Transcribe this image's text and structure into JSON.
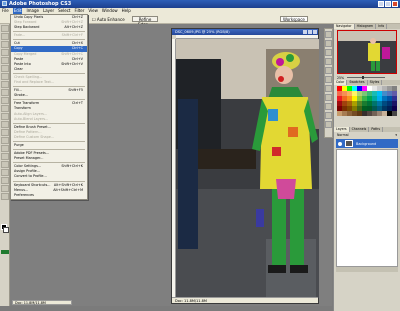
{
  "app": {
    "title": "Adobe Photoshop CS3",
    "accent": "#316ac5"
  },
  "menubar": {
    "items": [
      "File",
      "Edit",
      "Image",
      "Layer",
      "Select",
      "Filter",
      "View",
      "Window",
      "Help"
    ],
    "active": "Edit"
  },
  "options_bar": {
    "checkbox_label": "Auto Enhance",
    "refine_button": "Refine Edge...",
    "workspace_label": "Workspace"
  },
  "edit_menu": {
    "items": [
      {
        "label": "Undo Copy Pixels",
        "shortcut": "Ctrl+Z",
        "state": "normal"
      },
      {
        "label": "Step Forward",
        "shortcut": "Shift+Ctrl+Z",
        "state": "disabled"
      },
      {
        "label": "Step Backward",
        "shortcut": "Alt+Ctrl+Z",
        "state": "normal"
      },
      {
        "sep": true
      },
      {
        "label": "Fade...",
        "shortcut": "Shift+Ctrl+F",
        "state": "disabled"
      },
      {
        "sep": true
      },
      {
        "label": "Cut",
        "shortcut": "Ctrl+X",
        "state": "normal"
      },
      {
        "label": "Copy",
        "shortcut": "Ctrl+C",
        "state": "selected"
      },
      {
        "label": "Copy Merged",
        "shortcut": "Shift+Ctrl+C",
        "state": "disabled"
      },
      {
        "label": "Paste",
        "shortcut": "Ctrl+V",
        "state": "normal"
      },
      {
        "label": "Paste Into",
        "shortcut": "Shift+Ctrl+V",
        "state": "normal"
      },
      {
        "label": "Clear",
        "shortcut": "",
        "state": "normal"
      },
      {
        "sep": true
      },
      {
        "label": "Check Spelling...",
        "shortcut": "",
        "state": "disabled"
      },
      {
        "label": "Find and Replace Text...",
        "shortcut": "",
        "state": "disabled"
      },
      {
        "sep": true
      },
      {
        "label": "Fill...",
        "shortcut": "Shift+F5",
        "state": "normal"
      },
      {
        "label": "Stroke...",
        "shortcut": "",
        "state": "normal"
      },
      {
        "sep": true
      },
      {
        "label": "Free Transform",
        "shortcut": "Ctrl+T",
        "state": "normal"
      },
      {
        "label": "Transform",
        "shortcut": "",
        "state": "normal"
      },
      {
        "label": "Auto-Align Layers...",
        "shortcut": "",
        "state": "disabled"
      },
      {
        "label": "Auto-Blend Layers...",
        "shortcut": "",
        "state": "disabled"
      },
      {
        "sep": true
      },
      {
        "label": "Define Brush Preset...",
        "shortcut": "",
        "state": "normal"
      },
      {
        "label": "Define Pattern...",
        "shortcut": "",
        "state": "disabled"
      },
      {
        "label": "Define Custom Shape...",
        "shortcut": "",
        "state": "disabled"
      },
      {
        "sep": true
      },
      {
        "label": "Purge",
        "shortcut": "",
        "state": "normal"
      },
      {
        "sep": true
      },
      {
        "label": "Adobe PDF Presets...",
        "shortcut": "",
        "state": "normal"
      },
      {
        "label": "Preset Manager...",
        "shortcut": "",
        "state": "normal"
      },
      {
        "sep": true
      },
      {
        "label": "Color Settings...",
        "shortcut": "Shift+Ctrl+K",
        "state": "normal"
      },
      {
        "label": "Assign Profile...",
        "shortcut": "",
        "state": "normal"
      },
      {
        "label": "Convert to Profile...",
        "shortcut": "",
        "state": "normal"
      },
      {
        "sep": true
      },
      {
        "label": "Keyboard Shortcuts...",
        "shortcut": "Alt+Shift+Ctrl+K",
        "state": "normal"
      },
      {
        "label": "Menus...",
        "shortcut": "Alt+Shift+Ctrl+M",
        "state": "normal"
      },
      {
        "label": "Preferences",
        "shortcut": "",
        "state": "normal"
      }
    ]
  },
  "document": {
    "title": "DSC_0609.JPG @ 25% (RGB/8)",
    "zoom": "25%",
    "status": "Doc: 11.8M/11.8M"
  },
  "left_status": "Doc: 11.8M/11.8M",
  "panels": {
    "navigator_tabs": [
      "Navigator",
      "Histogram",
      "Info"
    ],
    "navigator_zoom": "25%",
    "color_tabs": [
      "Color",
      "Swatches",
      "Styles"
    ],
    "layers_tabs": [
      "Layers",
      "Channels",
      "Paths"
    ],
    "layers_mode": "Normal",
    "layer_name": "Background"
  },
  "swatch_colors": [
    "#ff0000",
    "#ffff00",
    "#00ff00",
    "#00ffff",
    "#0000ff",
    "#ff00ff",
    "#ffffff",
    "#e6e6e6",
    "#cccccc",
    "#b3b3b3",
    "#999999",
    "#808080",
    "#f26c4f",
    "#f68e55",
    "#fbaf5c",
    "#fff467",
    "#acd372",
    "#7cc576",
    "#3bb878",
    "#1abbb4",
    "#00bff3",
    "#438cca",
    "#5574b9",
    "#605ca8",
    "#ed1c24",
    "#f26522",
    "#f7941d",
    "#fff200",
    "#8dc63f",
    "#39b54a",
    "#00a651",
    "#00a99d",
    "#00aeef",
    "#0072bc",
    "#0054a6",
    "#2e3192",
    "#9e0b0f",
    "#a0410d",
    "#a3620a",
    "#aba000",
    "#598527",
    "#1a7b30",
    "#007236",
    "#00746b",
    "#0076a3",
    "#004b80",
    "#003471",
    "#1b1464",
    "#790000",
    "#7b2e00",
    "#7d4900",
    "#827b00",
    "#406618",
    "#005e20",
    "#005826",
    "#005952",
    "#005b7f",
    "#003663",
    "#002157",
    "#0d004c",
    "#c69c6d",
    "#a67c52",
    "#8c6239",
    "#754c24",
    "#603913",
    "#362f2d",
    "#534741",
    "#736357",
    "#998675",
    "#c7b299",
    "#000000",
    "#464646"
  ]
}
